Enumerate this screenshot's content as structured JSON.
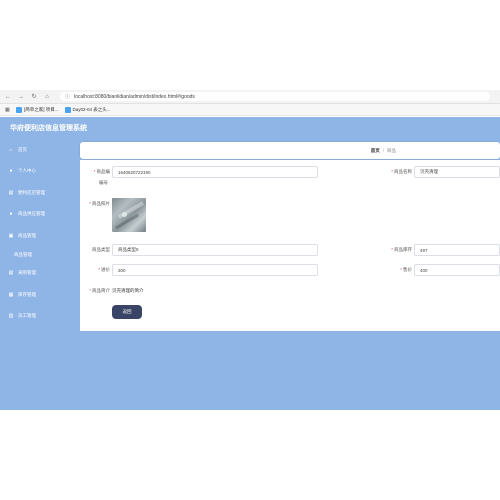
{
  "browser": {
    "url": "localhost:8080/bianlidian/admin/dist/index.html#/goods",
    "bookmarks": [
      {
        "label": "[简单之家] 项目..."
      },
      {
        "label": "Day02-04 表之头..."
      }
    ]
  },
  "app": {
    "title": "华府便利店信息管理系统"
  },
  "sidebar": {
    "items": [
      {
        "label": "首页",
        "icon": "home-icon"
      },
      {
        "label": "个人中心",
        "icon": "user-icon"
      },
      {
        "label": "便利店店管理",
        "icon": "store-icon"
      },
      {
        "label": "商品供应管理",
        "icon": "person-icon"
      },
      {
        "label": "商品管理",
        "icon": "goods-icon"
      },
      {
        "label": "商品管理",
        "sub": true
      },
      {
        "label": "采购管理",
        "icon": "cart-icon"
      },
      {
        "label": "库存管理",
        "icon": "box-icon"
      },
      {
        "label": "员工管理",
        "icon": "staff-icon"
      }
    ]
  },
  "breadcrumb": {
    "home": "首页",
    "separator": "/",
    "current": "商品"
  },
  "form": {
    "goods_no": {
      "label": "商品编",
      "label2": "编号",
      "value": "1640620722190"
    },
    "goods_name": {
      "label": "商品名称",
      "value": "贝壳清理"
    },
    "photo": {
      "label": "商品照片"
    },
    "goods_type": {
      "label": "商品类型",
      "value": "商品类型5"
    },
    "stock": {
      "label": "商品库存",
      "value": "497"
    },
    "purchase_price": {
      "label": "进价",
      "value": "300"
    },
    "sale_price": {
      "label": "售价",
      "value": "400"
    },
    "intro": {
      "label": "商品简介",
      "value": "贝壳清理的简介"
    },
    "back_label": "返回"
  },
  "colors": {
    "sidebar": "#8fb5e6",
    "header": "#8fb5e6",
    "button": "#3a4466"
  }
}
